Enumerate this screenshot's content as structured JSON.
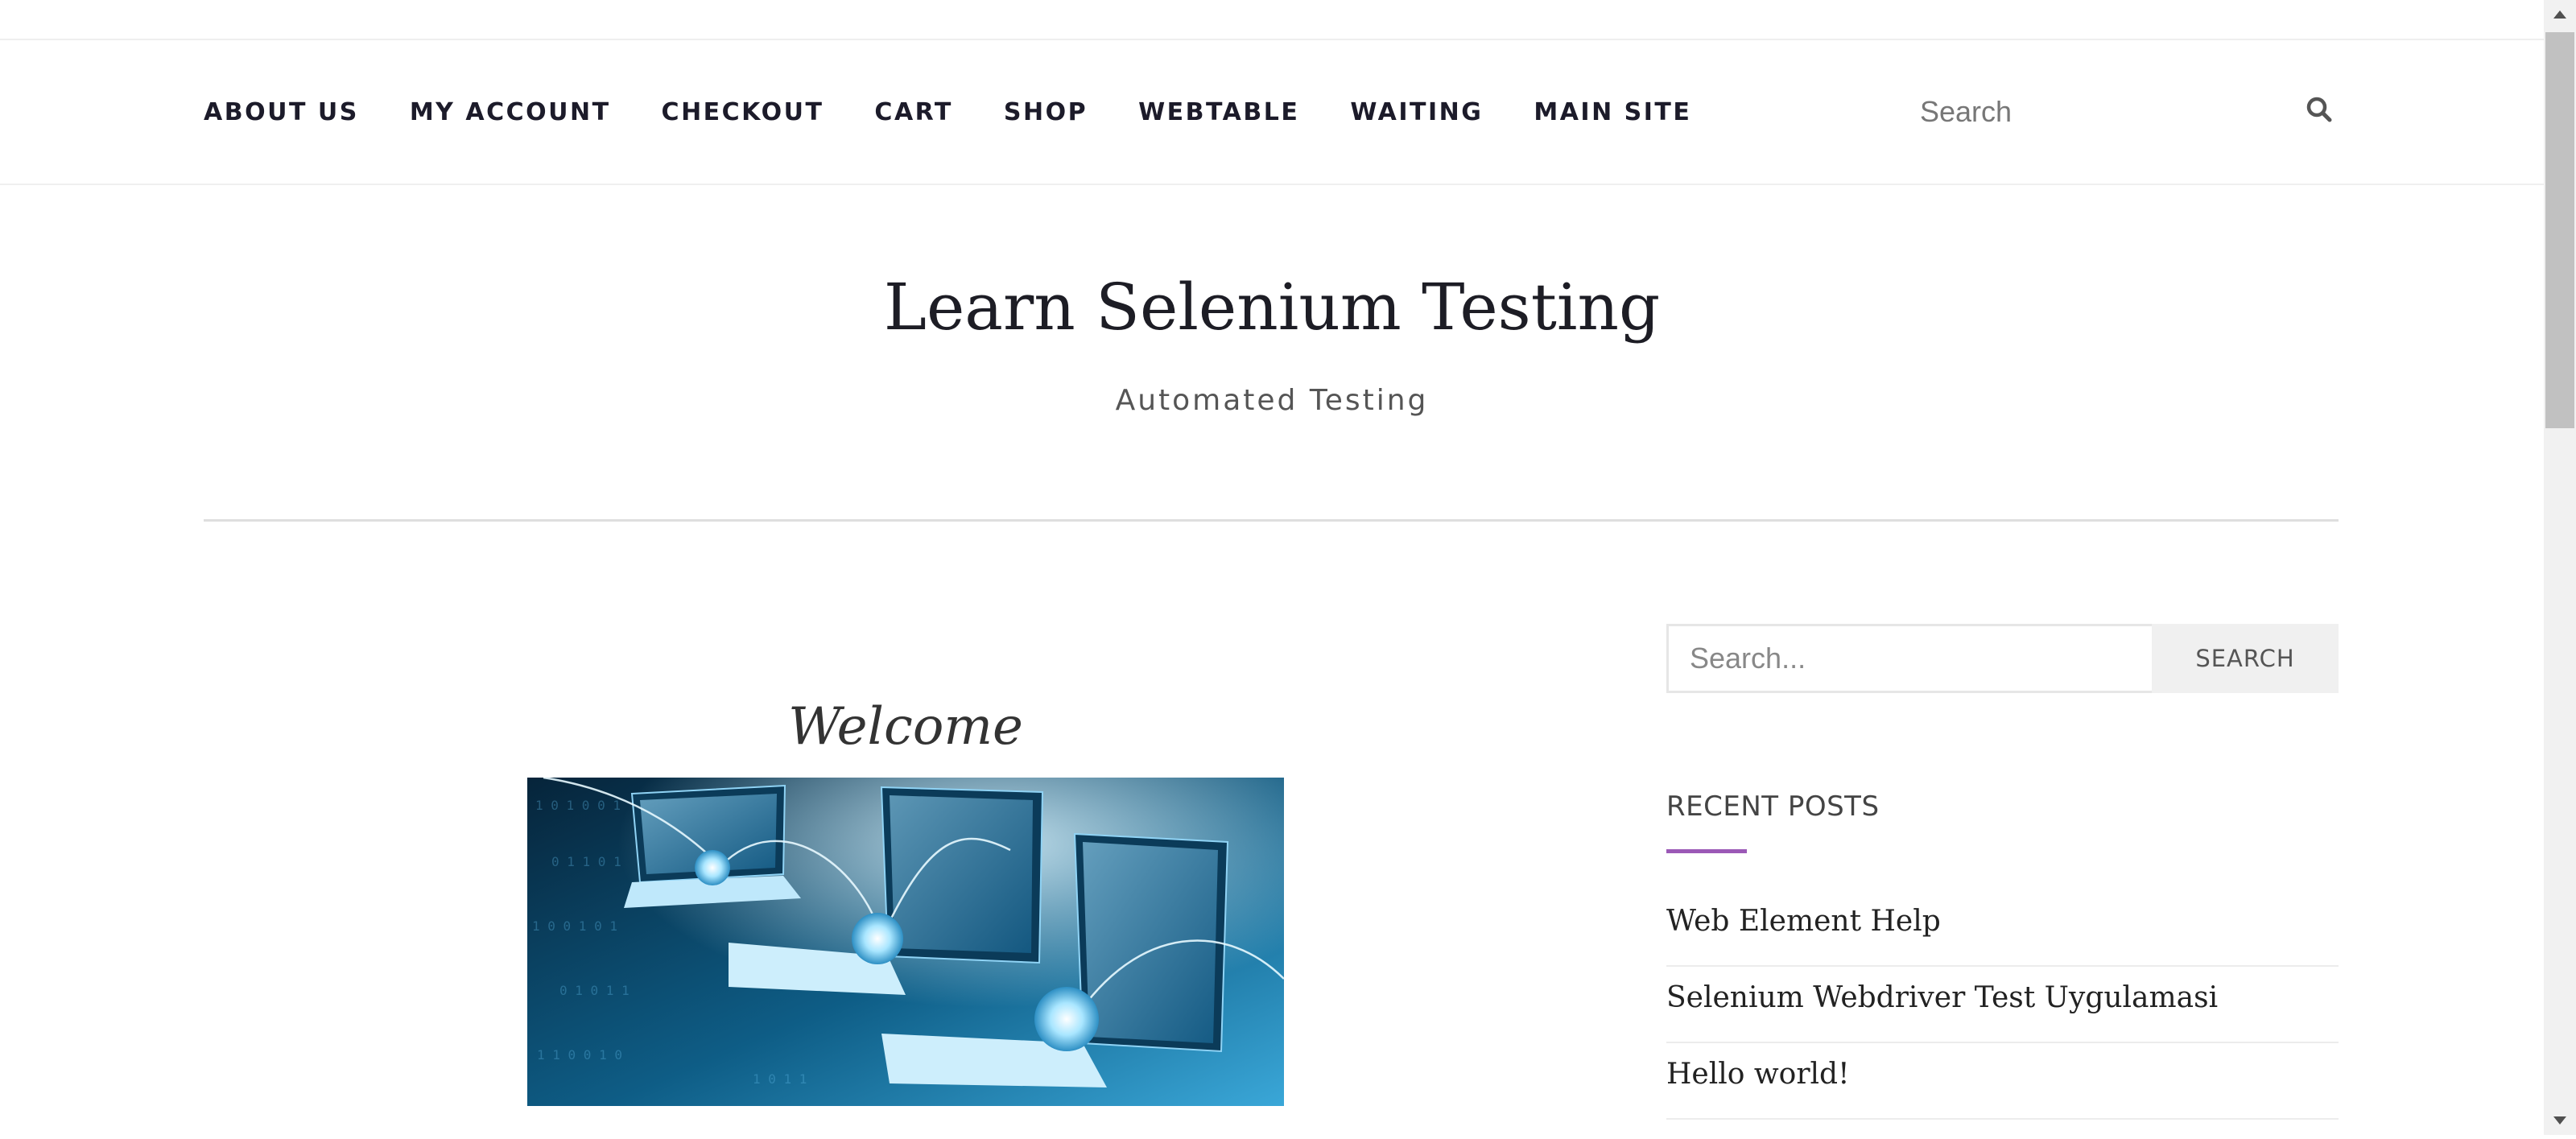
{
  "nav": {
    "items": [
      {
        "label": "ABOUT US"
      },
      {
        "label": "MY ACCOUNT"
      },
      {
        "label": "CHECKOUT"
      },
      {
        "label": "CART"
      },
      {
        "label": "SHOP"
      },
      {
        "label": "WEBTABLE"
      },
      {
        "label": "WAITING"
      },
      {
        "label": "MAIN SITE"
      }
    ]
  },
  "header_search": {
    "placeholder": "Search",
    "icon": "search-icon"
  },
  "site": {
    "title": "Learn Selenium Testing",
    "description": "Automated Testing"
  },
  "entry": {
    "title": "Welcome"
  },
  "sidebar": {
    "search": {
      "placeholder": "Search...",
      "button_label": "SEARCH"
    },
    "recent_posts": {
      "title": "RECENT POSTS",
      "items": [
        {
          "label": "Web Element Help"
        },
        {
          "label": "Selenium Webdriver Test Uygulamasi"
        },
        {
          "label": "Hello world!"
        }
      ]
    }
  },
  "colors": {
    "accent": "#9b59b6",
    "nav_text": "#1c1b2a",
    "divider": "#dedede"
  }
}
